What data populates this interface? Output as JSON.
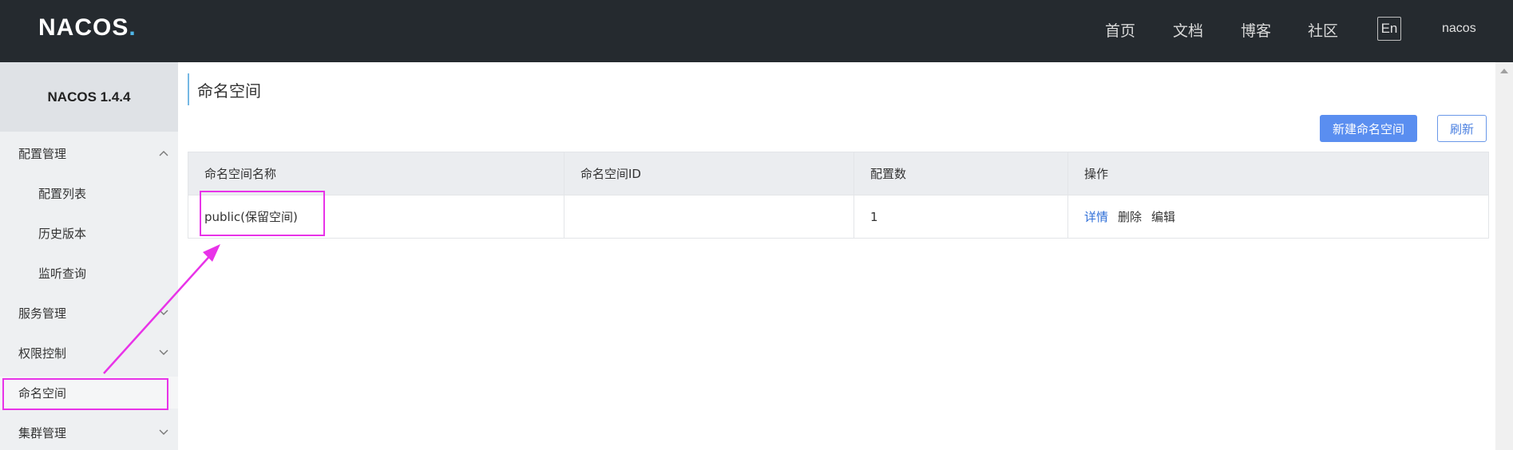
{
  "header": {
    "logo_text": "NACOS",
    "logo_dot": ".",
    "nav": [
      "首页",
      "文档",
      "博客",
      "社区"
    ],
    "lang_button": "En",
    "username": "nacos"
  },
  "sidebar": {
    "title": "NACOS 1.4.4",
    "items": [
      {
        "label": "配置管理",
        "chevron": "up"
      },
      {
        "label": "配置列表"
      },
      {
        "label": "历史版本"
      },
      {
        "label": "监听查询"
      },
      {
        "label": "服务管理",
        "chevron": "down"
      },
      {
        "label": "权限控制",
        "chevron": "down"
      },
      {
        "label": "命名空间"
      },
      {
        "label": "集群管理",
        "chevron": "down"
      }
    ]
  },
  "main": {
    "page_title": "命名空间",
    "new_button": "新建命名空间",
    "refresh_button": "刷新",
    "table": {
      "columns": [
        "命名空间名称",
        "命名空间ID",
        "配置数",
        "操作"
      ],
      "rows": [
        {
          "name": "public(保留空间)",
          "id": "",
          "count": "1",
          "actions": [
            "详情",
            "删除",
            "编辑"
          ]
        }
      ]
    }
  },
  "colors": {
    "header_bg": "#252a2f",
    "primary": "#5a8ef0",
    "annotation": "#e833e8"
  }
}
